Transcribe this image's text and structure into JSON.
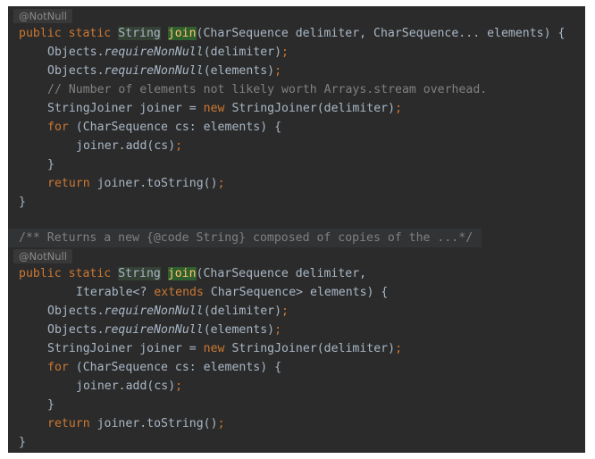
{
  "annotation": {
    "text": "@NotNull"
  },
  "block1": {
    "l1": {
      "public": "public",
      "static": "static",
      "type": "String",
      "fn": "join",
      "sig": "(CharSequence delimiter, CharSequence... elements) {"
    },
    "l2": {
      "a": "Objects.",
      "b": "requireNonNull",
      "c": "(delimiter)",
      "d": ";"
    },
    "l3": {
      "a": "Objects.",
      "b": "requireNonNull",
      "c": "(elements)",
      "d": ";"
    },
    "l4": {
      "text": "// Number of elements not likely worth Arrays.stream overhead."
    },
    "l5": {
      "a": "StringJoiner joiner = ",
      "b": "new",
      "c": " StringJoiner(delimiter)",
      "d": ";"
    },
    "l6": {
      "a": "for",
      "b": " (CharSequence cs: elements) {"
    },
    "l7": {
      "a": "joiner.add(cs)",
      "b": ";"
    },
    "l8": {
      "text": "}"
    },
    "l9": {
      "a": "return",
      "b": " joiner.toString()",
      "c": ";"
    },
    "l10": {
      "text": "}"
    }
  },
  "doc": {
    "text": "/** Returns a new {@code String} composed of copies of the ...*/"
  },
  "block2": {
    "l1": {
      "public": "public",
      "static": "static",
      "type": "String",
      "fn": "join",
      "sig": "(CharSequence delimiter,"
    },
    "l2": {
      "a": "Iterable<? ",
      "b": "extends",
      "c": " CharSequence> elements) {"
    },
    "l3": {
      "a": "Objects.",
      "b": "requireNonNull",
      "c": "(delimiter)",
      "d": ";"
    },
    "l4": {
      "a": "Objects.",
      "b": "requireNonNull",
      "c": "(elements)",
      "d": ";"
    },
    "l5": {
      "a": "StringJoiner joiner = ",
      "b": "new",
      "c": " StringJoiner(delimiter)",
      "d": ";"
    },
    "l6": {
      "a": "for",
      "b": " (CharSequence cs: elements) {"
    },
    "l7": {
      "a": "joiner.add(cs)",
      "b": ";"
    },
    "l8": {
      "text": "}"
    },
    "l9": {
      "a": "return",
      "b": " joiner.toString()",
      "c": ";"
    },
    "l10": {
      "text": "}"
    }
  }
}
